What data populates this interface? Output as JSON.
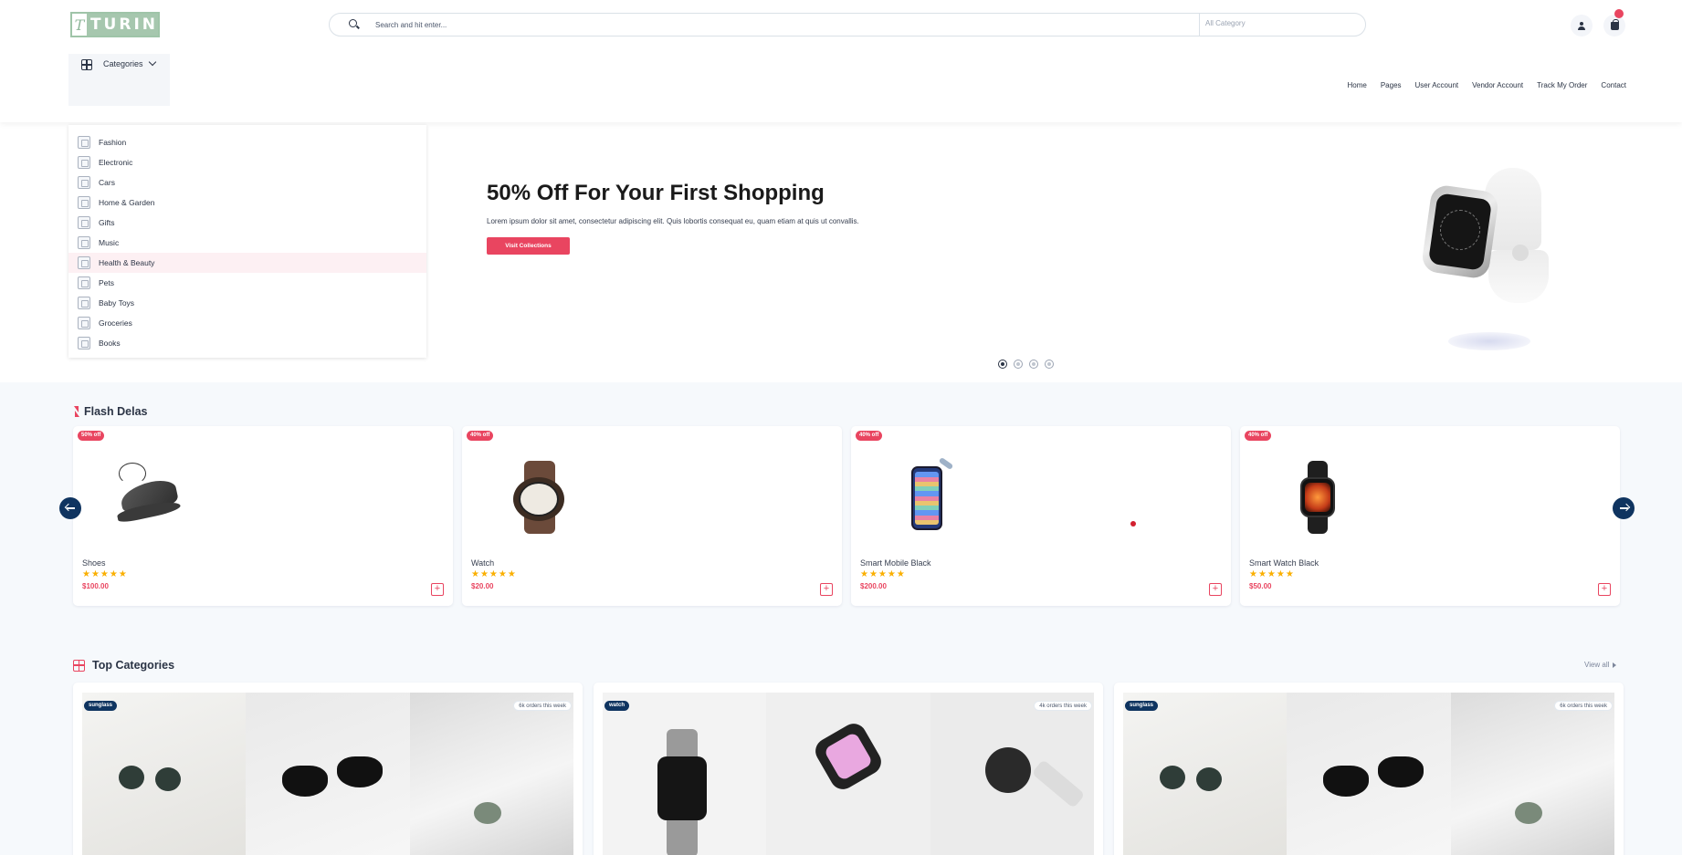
{
  "brand": {
    "logo_letter": "T",
    "logo_text": "TURIN"
  },
  "search": {
    "placeholder": "Search and hit enter...",
    "category": "All Category"
  },
  "header": {
    "categories_label": "Categories"
  },
  "nav": [
    "Home",
    "Pages",
    "User Account",
    "Vendor Account",
    "Track My Order",
    "Contact"
  ],
  "dropdown": [
    {
      "label": "Fashion",
      "active": false
    },
    {
      "label": "Electronic",
      "active": false
    },
    {
      "label": "Cars",
      "active": false
    },
    {
      "label": "Home & Garden",
      "active": false
    },
    {
      "label": "Gifts",
      "active": false
    },
    {
      "label": "Music",
      "active": false
    },
    {
      "label": "Health & Beauty",
      "active": true
    },
    {
      "label": "Pets",
      "active": false
    },
    {
      "label": "Baby Toys",
      "active": false
    },
    {
      "label": "Groceries",
      "active": false
    },
    {
      "label": "Books",
      "active": false
    }
  ],
  "hero": {
    "title": "50% Off For Your First Shopping",
    "text": "Lorem ipsum dolor sit amet, consectetur adipiscing elit. Quis lobortis consequat eu, quam etiam at quis ut convallis.",
    "button": "Visit Collections",
    "slide_count": 4,
    "active_slide": 1
  },
  "flash": {
    "title": "Flash Delas",
    "products": [
      {
        "name": "Shoes",
        "price": "$100.00",
        "discount": "50% off",
        "rating": 5
      },
      {
        "name": "Watch",
        "price": "$20.00",
        "discount": "40% off",
        "rating": 5
      },
      {
        "name": "Smart Mobile Black",
        "price": "$200.00",
        "discount": "40% off",
        "rating": 5
      },
      {
        "name": "Smart Watch Black",
        "price": "$50.00",
        "discount": "40% off",
        "rating": 5
      }
    ]
  },
  "top_categories": {
    "title": "Top Categories",
    "view_all": "View all",
    "cards": [
      {
        "tag": "sunglass",
        "orders": "6k orders this week"
      },
      {
        "tag": "watch",
        "orders": "4k orders this week"
      },
      {
        "tag": "sunglass",
        "orders": "6k orders this week"
      }
    ]
  },
  "colors": {
    "primary": "#e94560",
    "navy": "#0f3460",
    "star": "#faaf00",
    "text": "#2b3445"
  },
  "icons": [
    "search-icon",
    "user-icon",
    "shopping-bag-icon",
    "grid-icon",
    "chevron-down-icon",
    "bolt-icon",
    "arrow-left-icon",
    "arrow-right-icon",
    "plus-icon",
    "caret-right-icon"
  ]
}
